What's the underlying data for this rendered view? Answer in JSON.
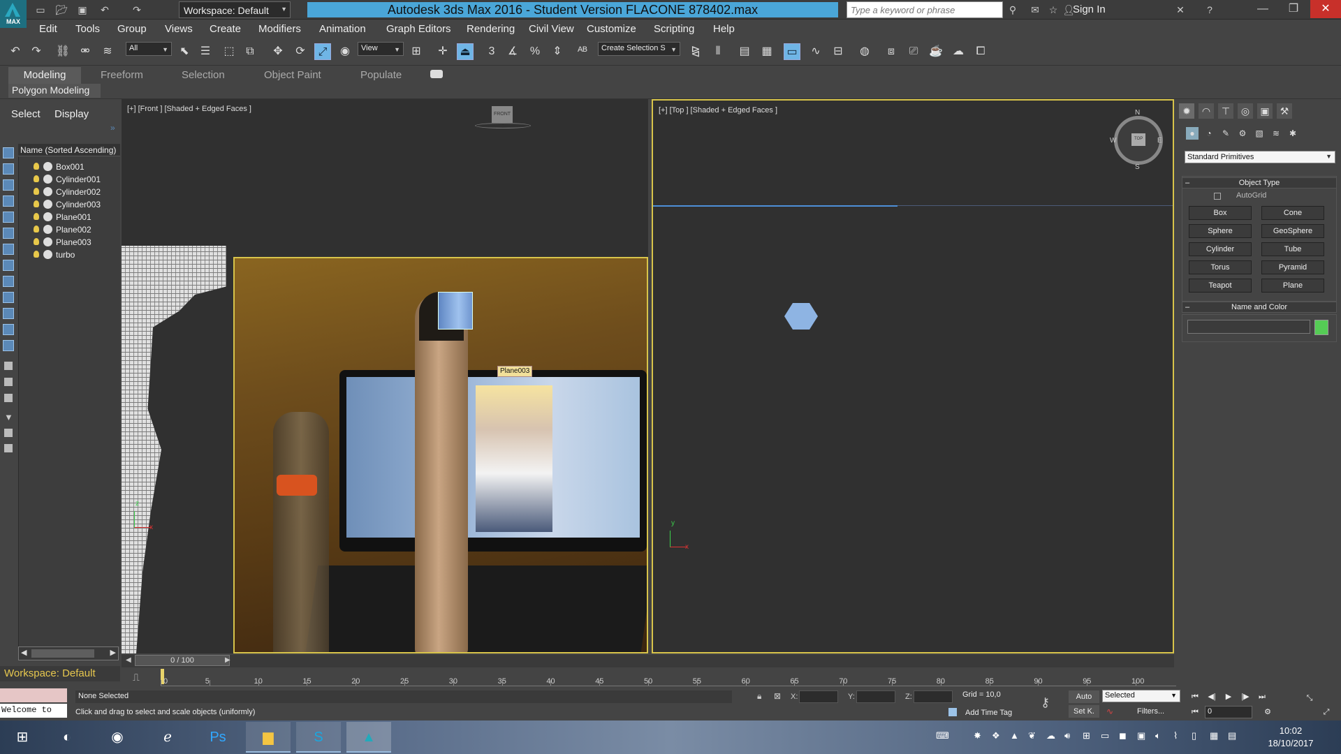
{
  "titlebar": {
    "logo_text": "MAX",
    "workspace": "Workspace: Default",
    "title": "Autodesk 3ds Max 2016 - Student Version    FLACONE 878402.max",
    "search_placeholder": "Type a keyword or phrase",
    "signin": "Sign In"
  },
  "menu": [
    "Edit",
    "Tools",
    "Group",
    "Views",
    "Create",
    "Modifiers",
    "Animation",
    "Graph Editors",
    "Rendering",
    "Civil View",
    "Customize",
    "Scripting",
    "Help"
  ],
  "toolbar": {
    "filter_select": "All",
    "refcoord_select": "View",
    "selection_set": "Create Selection S"
  },
  "ribbon": {
    "tabs": [
      "Modeling",
      "Freeform",
      "Selection",
      "Object Paint",
      "Populate"
    ],
    "panel": "Polygon Modeling"
  },
  "scene_explorer": {
    "select_label": "Select",
    "display_label": "Display",
    "header": "Name (Sorted Ascending)",
    "items": [
      "Box001",
      "Cylinder001",
      "Cylinder002",
      "Cylinder003",
      "Plane001",
      "Plane002",
      "Plane003",
      "turbo"
    ]
  },
  "viewports": {
    "front_label": "[+] [Front ] [Shaded + Edged Faces ]",
    "top_label": "[+] [Top ] [Shaded + Edged Faces ]",
    "tooltip": "Plane003",
    "viewcube_front": "FRONT",
    "viewcube_top": "TOP",
    "compass": {
      "n": "N",
      "s": "S",
      "e": "E",
      "w": "W"
    },
    "axis_z": "z",
    "axis_x": "x",
    "axis_y": "y"
  },
  "command_panel": {
    "category": "Standard Primitives",
    "object_type_header": "Object Type",
    "autogrid": "AutoGrid",
    "buttons": [
      "Box",
      "Cone",
      "Sphere",
      "GeoSphere",
      "Cylinder",
      "Tube",
      "Torus",
      "Pyramid",
      "Teapot",
      "Plane"
    ],
    "name_color_header": "Name and Color",
    "object_color": "#55cc55"
  },
  "timeline": {
    "slider": "0 / 100",
    "ticks": [
      "0",
      "5",
      "10",
      "15",
      "20",
      "25",
      "30",
      "35",
      "40",
      "45",
      "50",
      "55",
      "60",
      "65",
      "70",
      "75",
      "80",
      "85",
      "90",
      "95",
      "100"
    ]
  },
  "status": {
    "workspace_footer": "Workspace: Default",
    "welcome": "Welcome to",
    "selection_status": "None Selected",
    "prompt": "Click and drag to select and scale objects (uniformly)",
    "x_label": "X:",
    "y_label": "Y:",
    "z_label": "Z:",
    "grid": "Grid = 10,0",
    "add_time_tag": "Add Time Tag",
    "auto": "Auto",
    "set_key": "Set K.",
    "key_filter_select": "Selected",
    "filters": "Filters...",
    "frame": "0"
  },
  "taskbar": {
    "time": "10:02",
    "date": "18/10/2017",
    "apps": [
      "start",
      "cortana",
      "chrome",
      "internet-explorer",
      "photoshop",
      "file-explorer",
      "skype",
      "3ds-max"
    ]
  }
}
